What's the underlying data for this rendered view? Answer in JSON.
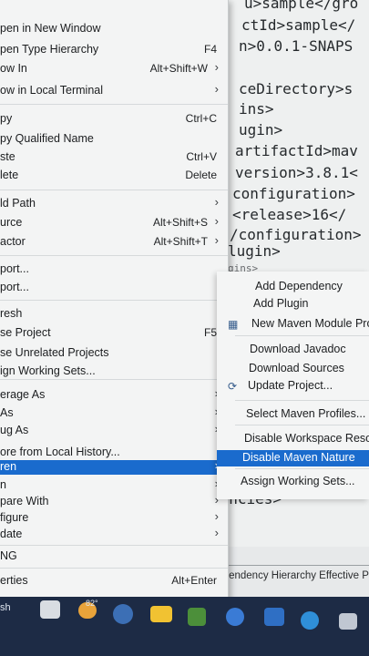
{
  "editor": {
    "lines": [
      "u>sample</gro",
      "ctId>sample</",
      "n>0.0.1-SNAPS",
      "ceDirectory>s",
      "ins>",
      "ugin>",
      "artifactId>mav",
      "version>3.8.1<",
      "configuration>",
      " <release>16</",
      "/configuration>",
      "lugin>",
      "gins>",
      "dencies>"
    ],
    "bottom_tabs": "Dependency Hierarchy  Effective P"
  },
  "menu": {
    "items": [
      {
        "label": "pen in New Window",
        "shortcut": "",
        "arrow": false
      },
      {
        "label": "pen Type Hierarchy",
        "shortcut": "F4",
        "arrow": false
      },
      {
        "label": "ow In",
        "shortcut": "Alt+Shift+W",
        "arrow": true
      },
      {
        "label": "ow in Local Terminal",
        "shortcut": "",
        "arrow": true
      },
      {
        "label": "py",
        "shortcut": "Ctrl+C",
        "arrow": false
      },
      {
        "label": "py Qualified Name",
        "shortcut": "",
        "arrow": false
      },
      {
        "label": "ste",
        "shortcut": "Ctrl+V",
        "arrow": false
      },
      {
        "label": "lete",
        "shortcut": "Delete",
        "arrow": false
      },
      {
        "label": "ld Path",
        "shortcut": "",
        "arrow": true
      },
      {
        "label": "urce",
        "shortcut": "Alt+Shift+S",
        "arrow": true
      },
      {
        "label": "actor",
        "shortcut": "Alt+Shift+T",
        "arrow": true
      },
      {
        "label": "port...",
        "shortcut": "",
        "arrow": false
      },
      {
        "label": "port...",
        "shortcut": "",
        "arrow": false
      },
      {
        "label": "resh",
        "shortcut": "",
        "arrow": false
      },
      {
        "label": "se Project",
        "shortcut": "F5",
        "arrow": false
      },
      {
        "label": "se Unrelated Projects",
        "shortcut": "",
        "arrow": false
      },
      {
        "label": "ign Working Sets...",
        "shortcut": "",
        "arrow": false
      },
      {
        "label": "erage As",
        "shortcut": "",
        "arrow": true
      },
      {
        "label": "As",
        "shortcut": "",
        "arrow": true
      },
      {
        "label": "ug As",
        "shortcut": "",
        "arrow": true
      },
      {
        "label": "ore from Local History...",
        "shortcut": "",
        "arrow": false
      },
      {
        "label": "ren",
        "shortcut": "",
        "arrow": true
      },
      {
        "label": "n",
        "shortcut": "",
        "arrow": true
      },
      {
        "label": "pare With",
        "shortcut": "",
        "arrow": true
      },
      {
        "label": "figure",
        "shortcut": "",
        "arrow": true
      },
      {
        "label": "date",
        "shortcut": "",
        "arrow": true
      },
      {
        "label": "NG",
        "shortcut": "",
        "arrow": false
      },
      {
        "label": "erties",
        "shortcut": "Alt+Enter",
        "arrow": false
      }
    ]
  },
  "submenu": {
    "items": [
      {
        "label": "Add Dependency",
        "icon": ""
      },
      {
        "label": "Add Plugin",
        "icon": ""
      },
      {
        "label": "New Maven Module Pro",
        "icon": "maven-module-icon"
      },
      {
        "label": "Download Javadoc",
        "icon": ""
      },
      {
        "label": "Download Sources",
        "icon": ""
      },
      {
        "label": "Update Project...",
        "icon": "update-icon"
      },
      {
        "label": "Select Maven Profiles...",
        "icon": ""
      },
      {
        "label": "Disable Workspace Resolu",
        "icon": ""
      },
      {
        "label": "Disable Maven Nature",
        "icon": ""
      },
      {
        "label": "Assign Working Sets...",
        "icon": ""
      }
    ]
  },
  "taskbar": {
    "search_text": "sh",
    "weather": "82°"
  },
  "colors": {
    "selection": "#1a6bcd",
    "taskbar": "#1d2b45"
  }
}
